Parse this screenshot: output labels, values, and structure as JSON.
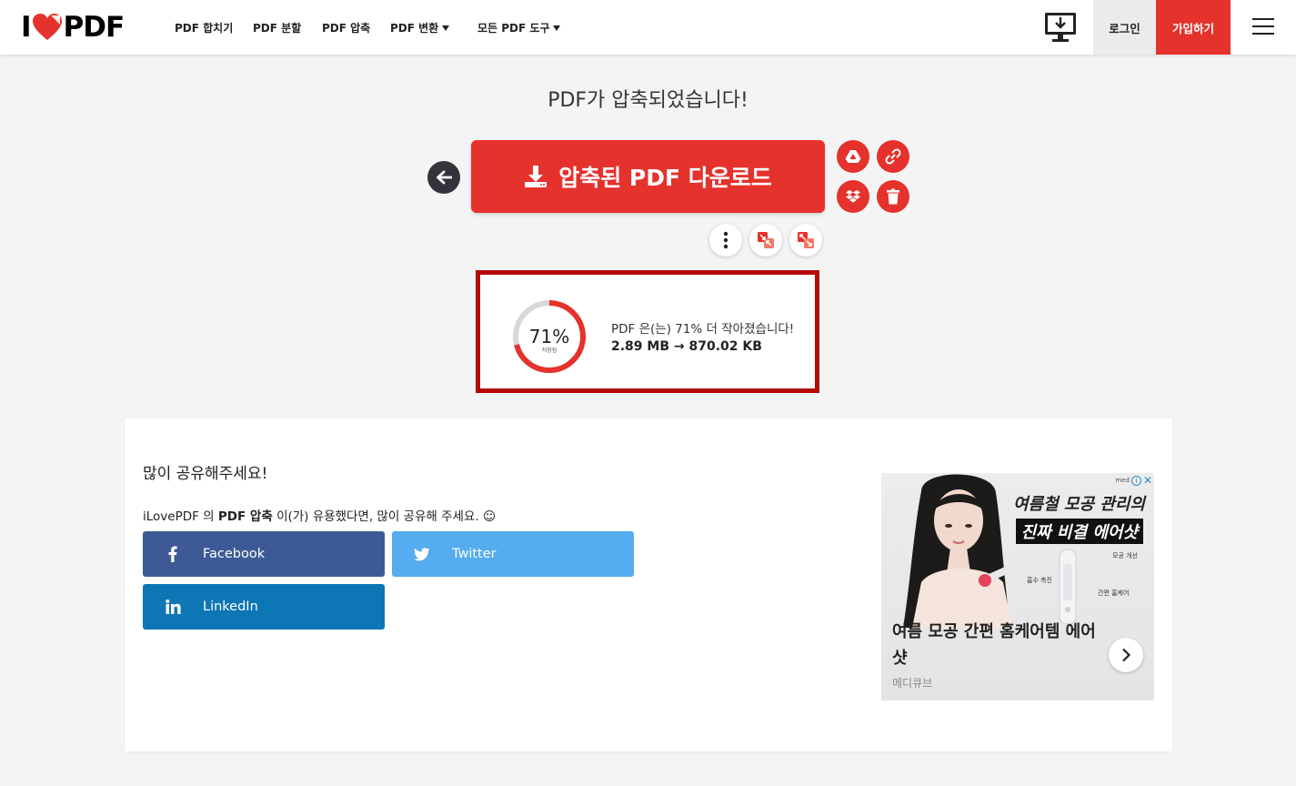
{
  "header": {
    "logo_left": "I",
    "logo_right": "PDF",
    "nav": [
      {
        "label": "PDF 합치기",
        "has_caret": false
      },
      {
        "label": "PDF 분할",
        "has_caret": false
      },
      {
        "label": "PDF 압축",
        "has_caret": false
      },
      {
        "label": "PDF 변환",
        "has_caret": true
      },
      {
        "label": "모든 PDF 도구",
        "has_caret": true
      }
    ],
    "login": "로그인",
    "signup": "가입하기"
  },
  "result": {
    "title": "PDF가 압축되었습니다!",
    "download_label": "압축된 PDF 다운로드",
    "saved_percent": 71,
    "saved_label": "71%",
    "saved_caption": "저장됨",
    "summary": "PDF 은(는) 71% 더 작아졌습니다!",
    "size_before": "2.89 MB",
    "size_after": "870.02 KB"
  },
  "share": {
    "title": "많이 공유해주세요!",
    "desc_prefix": "iLovePDF 의 ",
    "desc_tool": "PDF 압축",
    "desc_suffix": " 이(가) 유용했다면, 많이 공유해 주세요. ☺",
    "buttons": [
      {
        "label": "Facebook",
        "icon": "facebook-icon"
      },
      {
        "label": "Twitter",
        "icon": "twitter-icon"
      },
      {
        "label": "LinkedIn",
        "icon": "linkedin-icon"
      }
    ]
  },
  "ad": {
    "headline_1": "여름철 모공 관리의",
    "headline_2a": "진짜 비결 ",
    "headline_2b": "에어샷",
    "label_1": "모공 개선",
    "label_2": "흡수 촉진",
    "label_3": "간편 홈케어",
    "title": "여름 모공 간편 홈케어템 에어샷",
    "advertiser": "메디큐브",
    "badge": "med"
  },
  "colors": {
    "brand_red": "#e5322d",
    "highlight_border": "#b5090a",
    "facebook": "#3d5a96",
    "twitter": "#55acee",
    "linkedin": "#0d76b5"
  }
}
